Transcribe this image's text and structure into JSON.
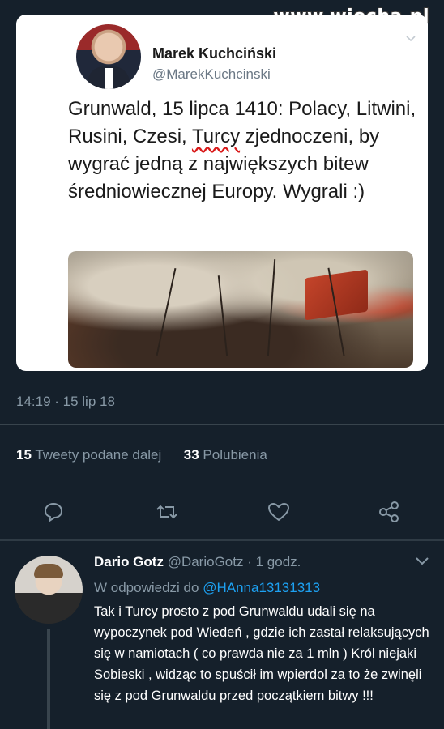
{
  "watermark": "www.wiocha.pl",
  "tweet": {
    "author_name": "Marek Kuchciński",
    "author_handle": "@MarekKuchcinski",
    "text_before": "Grunwald, 15 lipca 1410: Polacy, Litwini, Rusini, Czesi, ",
    "text_underlined": "Turcy",
    "text_after": " zjednoczeni, by wygrać jedną z największych bitew średniowiecznej Europy. Wygrali :)",
    "timestamp": "14:19 · 15 lip 18",
    "retweets_count": "15",
    "retweets_label": "Tweety podane dalej",
    "likes_count": "33",
    "likes_label": "Polubienia"
  },
  "actions": [
    {
      "name": "reply",
      "icon": "speech-bubble-icon"
    },
    {
      "name": "retweet",
      "icon": "retweet-icon"
    },
    {
      "name": "like",
      "icon": "heart-icon"
    },
    {
      "name": "share",
      "icon": "share-icon"
    }
  ],
  "reply": {
    "author_name": "Dario Gotz",
    "author_handle": "@DarioGotz",
    "time": "· 1 godz.",
    "in_reply_to_label": "W odpowiedzi do",
    "in_reply_to_handle": "@HAnna13131313",
    "text": "Tak i Turcy prosto z pod Grunwaldu udali się na wypoczynek pod Wiedeń , gdzie ich zastał relaksujących się w namiotach ( co prawda nie za 1 mln ) Król niejaki Sobieski , widząc to spuścił im wpierdol za to że zwinęli się z pod Grunwaldu przed początkiem bitwy !!!"
  },
  "colors": {
    "background": "#15202b",
    "secondary_text": "#8899a6",
    "accent": "#1da1f2",
    "spellcheck_underline": "#d91a1a"
  }
}
